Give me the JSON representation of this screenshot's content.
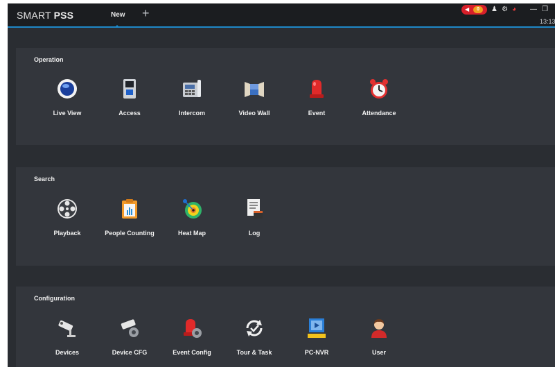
{
  "header": {
    "brand_light": "SMART ",
    "brand_bold": "PSS",
    "tab_label": "New",
    "add_tab": "+",
    "alarm_count": "0",
    "time": "13:13:"
  },
  "sections": {
    "operation": {
      "title": "Operation",
      "items": [
        "Live View",
        "Access",
        "Intercom",
        "Video Wall",
        "Event",
        "Attendance"
      ]
    },
    "search": {
      "title": "Search",
      "items": [
        "Playback",
        "People Counting",
        "Heat Map",
        "Log"
      ]
    },
    "configuration": {
      "title": "Configuration",
      "items": [
        "Devices",
        "Device CFG",
        "Event Config",
        "Tour & Task",
        "PC-NVR",
        "User"
      ]
    }
  },
  "colors": {
    "background": "#2a2d32",
    "panel": "#33363c",
    "topbar": "#1b1d20",
    "accent": "#1e88c8",
    "alarm": "#d8202a"
  },
  "icons": {
    "operation": [
      "live-view-icon",
      "access-icon",
      "intercom-icon",
      "video-wall-icon",
      "event-icon",
      "attendance-icon"
    ],
    "search": [
      "playback-icon",
      "people-counting-icon",
      "heat-map-icon",
      "log-icon"
    ],
    "configuration": [
      "devices-icon",
      "device-cfg-icon",
      "event-config-icon",
      "tour-task-icon",
      "pc-nvr-icon",
      "user-icon"
    ]
  }
}
